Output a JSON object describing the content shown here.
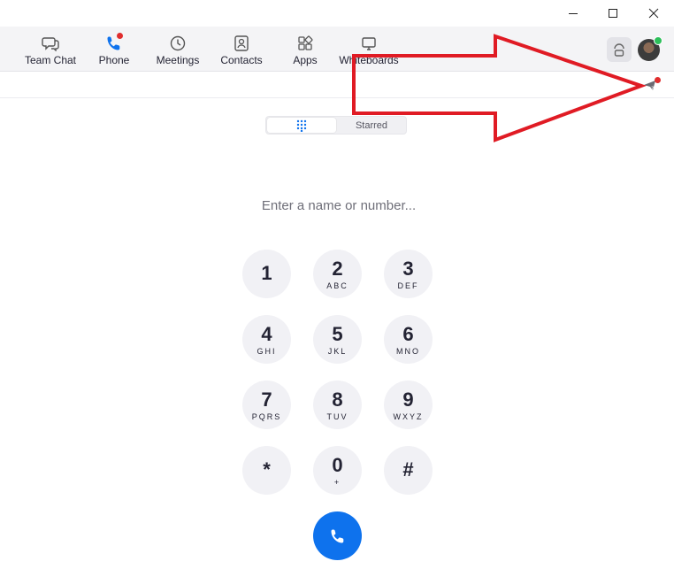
{
  "nav": {
    "items": [
      {
        "label": "Team Chat",
        "icon": "chat-icon"
      },
      {
        "label": "Phone",
        "icon": "phone-icon",
        "notification": true
      },
      {
        "label": "Meetings",
        "icon": "clock-icon"
      },
      {
        "label": "Contacts",
        "icon": "contact-card-icon"
      },
      {
        "label": "Apps",
        "icon": "apps-icon"
      },
      {
        "label": "Whiteboards",
        "icon": "whiteboard-icon"
      }
    ]
  },
  "dialer": {
    "tabs": {
      "keypad_icon": "keypad-icon",
      "starred": "Starred"
    },
    "input_placeholder": "Enter a name or number...",
    "keys": [
      {
        "digit": "1",
        "letters": ""
      },
      {
        "digit": "2",
        "letters": "ABC"
      },
      {
        "digit": "3",
        "letters": "DEF"
      },
      {
        "digit": "4",
        "letters": "GHI"
      },
      {
        "digit": "5",
        "letters": "JKL"
      },
      {
        "digit": "6",
        "letters": "MNO"
      },
      {
        "digit": "7",
        "letters": "PQRS"
      },
      {
        "digit": "8",
        "letters": "TUV"
      },
      {
        "digit": "9",
        "letters": "WXYZ"
      },
      {
        "digit": "*",
        "letters": ""
      },
      {
        "digit": "0",
        "letters": "+"
      },
      {
        "digit": "#",
        "letters": ""
      }
    ]
  },
  "colors": {
    "call_button": "#0e72ed",
    "notification_dot": "#e02d2d",
    "presence_dot": "#2dbf5a",
    "annotation_arrow": "#e01b24"
  }
}
